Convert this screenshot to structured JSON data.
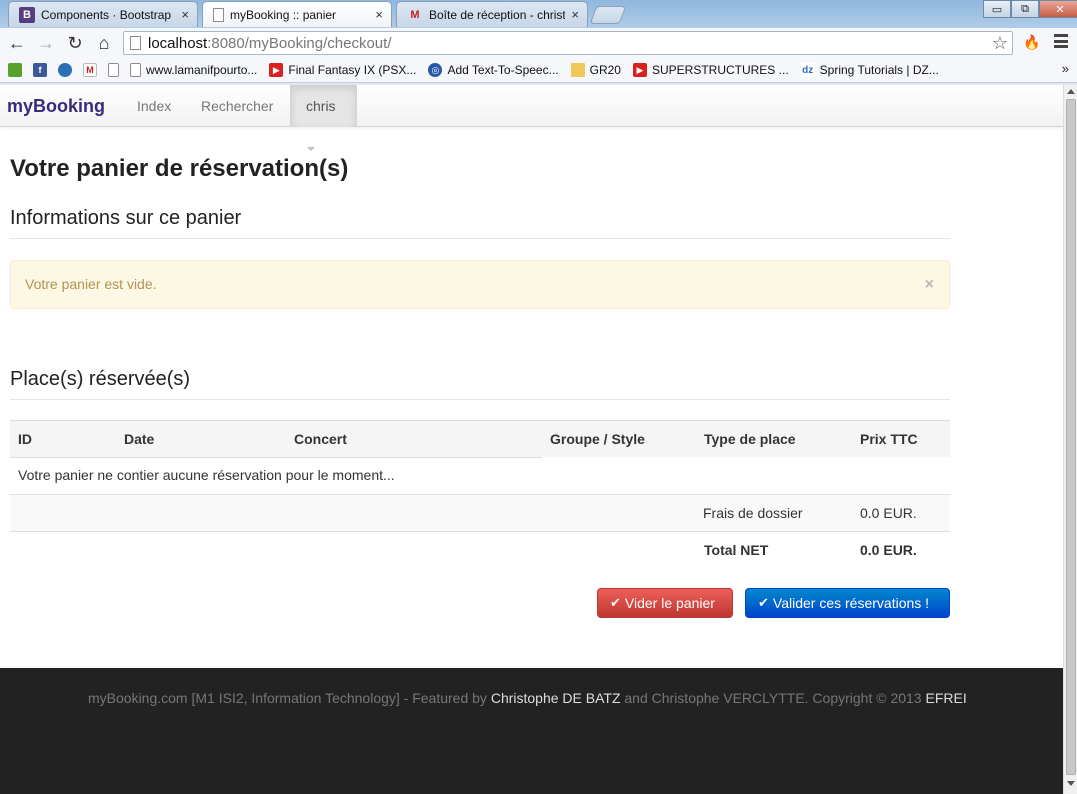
{
  "browser": {
    "tabs": [
      {
        "title": "Components · Bootstrap",
        "favicon": "bootstrap-favicon",
        "favicon_text": "B",
        "active": false
      },
      {
        "title": "myBooking :: panier",
        "favicon": "page-favicon",
        "active": true
      },
      {
        "title": "Boîte de réception - christ",
        "favicon": "gmail-favicon",
        "favicon_text": "M",
        "active": false
      }
    ],
    "close_glyph": "×",
    "window_controls": {
      "minimize": "▭",
      "maximize": "⧉",
      "close": "✕"
    },
    "nav": {
      "back": "←",
      "forward": "→",
      "reload": "↻",
      "home": "⌂"
    },
    "url": {
      "host": "localhost",
      "rest": ":8080/myBooking/checkout/"
    },
    "star_glyph": "☆",
    "extension_glyph": "🔥",
    "bookmarks": [
      {
        "label": "",
        "icon": "green-box-icon"
      },
      {
        "label": "",
        "icon": "facebook-icon",
        "text": "f"
      },
      {
        "label": "",
        "icon": "dropbox-icon",
        "text": ""
      },
      {
        "label": "",
        "icon": "gmail-icon",
        "text": "M"
      },
      {
        "label": "",
        "icon": "page-icon",
        "text": ""
      },
      {
        "label": "www.lamanifpourto...",
        "icon": "page-icon",
        "text": ""
      },
      {
        "label": "Final Fantasy IX (PSX...",
        "icon": "youtube-icon",
        "text": "▶"
      },
      {
        "label": "Add Text-To-Speec...",
        "icon": "circle-icon",
        "text": "◎"
      },
      {
        "label": "GR20",
        "icon": "folder-icon",
        "text": ""
      },
      {
        "label": "SUPERSTRUCTURES ...",
        "icon": "youtube-icon",
        "text": "▶"
      },
      {
        "label": "Spring Tutorials | DZ...",
        "icon": "dzone-icon",
        "text": "dz"
      }
    ],
    "bookmarks_more": "»"
  },
  "navbar": {
    "brand": "myBooking",
    "links": [
      "Index",
      "Rechercher"
    ],
    "user": "chris"
  },
  "page": {
    "title": "Votre panier de réservation(s)",
    "info_section": "Informations sur ce panier",
    "alert": {
      "message": "Votre panier est vide.",
      "close": "×"
    },
    "reserved_section": "Place(s) réservée(s)"
  },
  "table": {
    "headers": [
      "ID",
      "Date",
      "Concert",
      "Groupe / Style",
      "Type de place",
      "Prix TTC"
    ],
    "empty_message": "Votre panier ne contier aucune réservation pour le moment...",
    "fees_label": "Frais de dossier",
    "fees_value": "0.0 EUR.",
    "total_label": "Total NET",
    "total_value": "0.0 EUR."
  },
  "buttons": {
    "empty_cart": "Vider le panier",
    "validate": "Valider ces réservations !",
    "check_glyph": "✔"
  },
  "footer": {
    "part1": "myBooking.com [M1 ISI2, Information Technology] - Featured by ",
    "author1": "Christophe DE BATZ",
    "part2": " and Christophe VERCLYTTE. Copyright © 2013 ",
    "school": "EFREI"
  },
  "colors": {
    "brand": "#3a2a7a",
    "alert_bg": "#fcf8e3",
    "alert_text": "#b39159",
    "danger": "#da4f49",
    "primary": "#0066cc",
    "footer_bg": "#222222"
  }
}
